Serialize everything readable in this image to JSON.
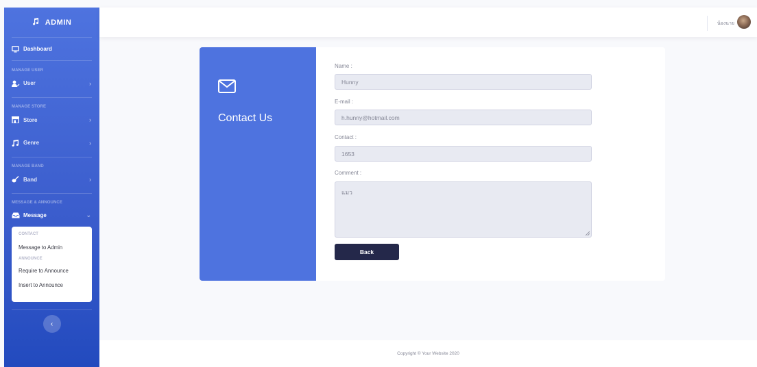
{
  "sidebar": {
    "brand": "ADMIN",
    "dashboard": "Dashboard",
    "headings": {
      "manage_user": "MANAGE USER",
      "manage_store": "MANAGE STORE",
      "manage_band": "MANAGE BAND",
      "message_announce": "MESSAGE & ANNOUNCE"
    },
    "items": {
      "user": "User",
      "store": "Store",
      "genre": "Genre",
      "band": "Band",
      "message": "Message"
    },
    "submenu": {
      "contact_heading": "CONTACT",
      "message_to_admin": "Message to Admin",
      "announce_heading": "ANNOUNCE",
      "require_to_announce": "Require to Announce",
      "insert_to_announce": "Insert to Announce"
    },
    "toggle_glyph": "‹"
  },
  "topbar": {
    "username": "น้องนาย"
  },
  "card": {
    "title": "Contact Us",
    "fields": {
      "name_label": "Name :",
      "name_value": "Hunny",
      "email_label": "E-mail :",
      "email_value": "h.hunny@hotmail.com",
      "contact_label": "Contact :",
      "contact_value": "1653",
      "comment_label": "Comment :",
      "comment_value": "แมว"
    },
    "back_label": "Back"
  },
  "footer": {
    "copyright": "Copyright © Your Website 2020"
  },
  "colors": {
    "primary": "#4e73df",
    "button_dark": "#24284a",
    "input_bg": "#e8eaf2"
  }
}
